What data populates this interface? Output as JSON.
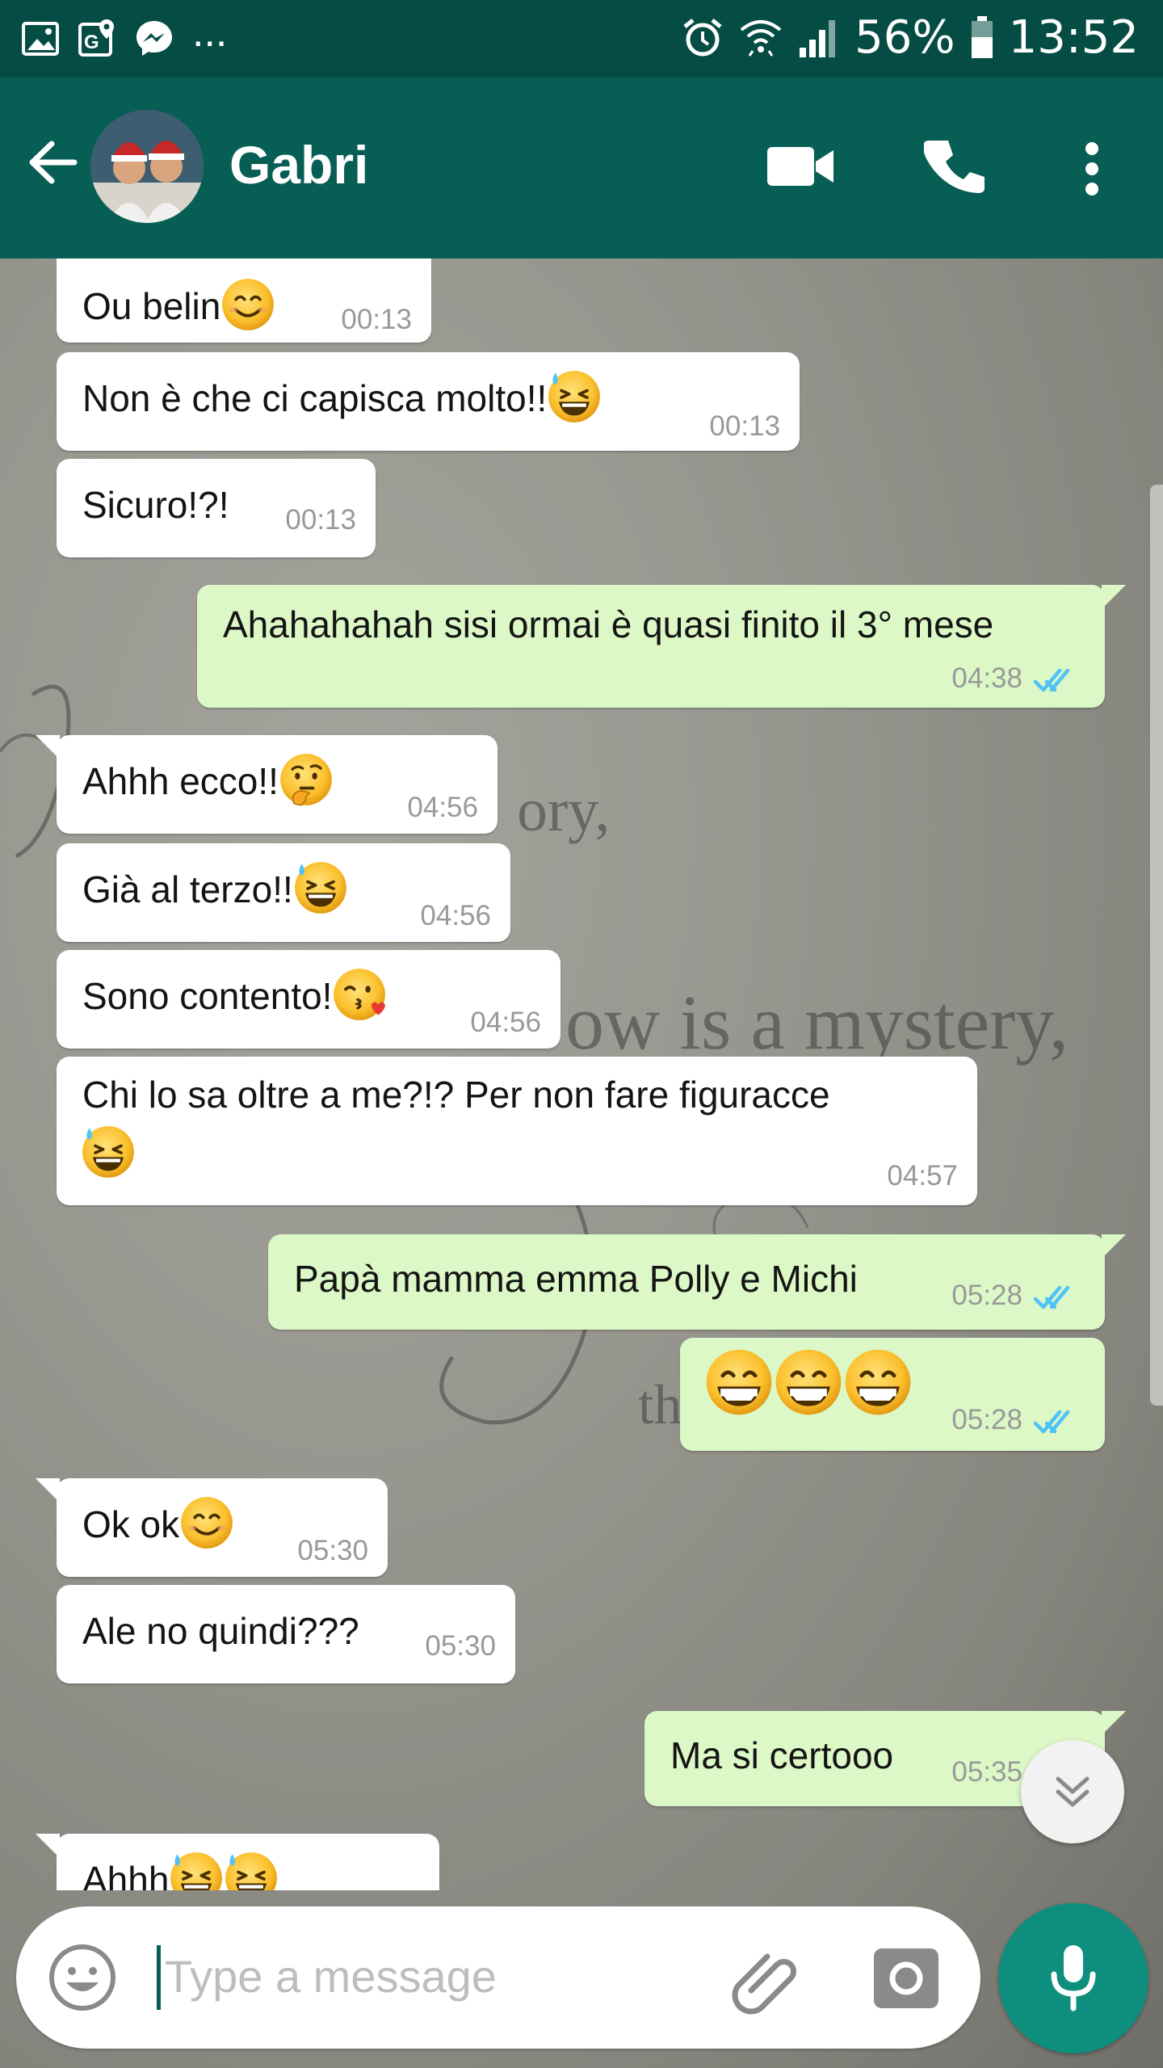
{
  "status_bar": {
    "battery": "56%",
    "time": "13:52",
    "more": "..."
  },
  "header": {
    "contact_name": "Gabri"
  },
  "messages": [
    {
      "dir": "in",
      "text": "Ou belin",
      "emoji": [
        "smile"
      ],
      "time": "00:13"
    },
    {
      "dir": "in",
      "text": "Non è che ci capisca molto!!",
      "emoji": [
        "sweat"
      ],
      "time": "00:13"
    },
    {
      "dir": "in",
      "text": "Sicuro!?!",
      "time": "00:13"
    },
    {
      "dir": "out",
      "text": "Ahahahahah sisi ormai è quasi finito il 3° mese",
      "time": "04:38",
      "status": "read"
    },
    {
      "dir": "in",
      "text": "Ahhh ecco!!",
      "emoji": [
        "thinking"
      ],
      "time": "04:56"
    },
    {
      "dir": "in",
      "text": "Già al terzo!!",
      "emoji": [
        "sweat"
      ],
      "time": "04:56"
    },
    {
      "dir": "in",
      "text": "Sono contento!",
      "emoji": [
        "kiss"
      ],
      "time": "04:56"
    },
    {
      "dir": "in",
      "text": "Chi lo sa oltre a me?!? Per non fare figuracce",
      "emoji": [
        "sweat"
      ],
      "time": "04:57"
    },
    {
      "dir": "out",
      "text": "Papà mamma emma Polly e Michi",
      "time": "05:28",
      "status": "read"
    },
    {
      "dir": "out",
      "text": "",
      "emoji": [
        "grin",
        "grin",
        "grin"
      ],
      "time": "05:28",
      "status": "read"
    },
    {
      "dir": "in",
      "text": "Ok ok",
      "emoji": [
        "smile"
      ],
      "time": "05:30"
    },
    {
      "dir": "in",
      "text": "Ale no quindi???",
      "time": "05:30"
    },
    {
      "dir": "out",
      "text": "Ma si certooo",
      "time": "05:35",
      "status": "read"
    },
    {
      "dir": "in",
      "text": "Ahhh",
      "emoji": [
        "sweat",
        "sweat"
      ],
      "time": ""
    }
  ],
  "input": {
    "placeholder": "Type a message"
  },
  "colors": {
    "header": "#075e54",
    "status_bar": "#054d44",
    "outgoing": "#dcf8c6",
    "incoming": "#ffffff",
    "read_ticks": "#4fc3f7",
    "mic": "#0e8f7e"
  },
  "icons": [
    "gallery-icon",
    "maps-icon",
    "messenger-icon",
    "alarm-icon",
    "wifi-icon",
    "signal-icon",
    "battery-icon",
    "back-arrow-icon",
    "video-call-icon",
    "phone-icon",
    "more-vert-icon",
    "emoji-icon",
    "attach-icon",
    "camera-icon",
    "mic-icon",
    "scroll-down-icon"
  ]
}
